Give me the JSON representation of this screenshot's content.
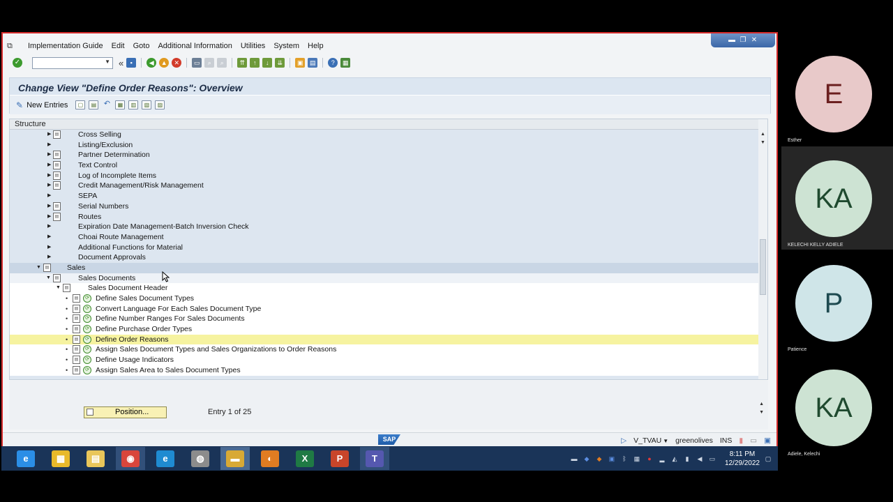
{
  "menubar": {
    "items": [
      "Implementation Guide",
      "Edit",
      "Goto",
      "Additional Information",
      "Utilities",
      "System",
      "Help"
    ]
  },
  "toolbar": {
    "command_value": "",
    "back_glyph": "«"
  },
  "window": {
    "title": "Change View \"Define Order Reasons\": Overview",
    "new_entries_label": "New Entries"
  },
  "tree": {
    "header": "Structure",
    "rows": [
      {
        "label": "Cross Selling",
        "indent": 2,
        "expander": "right",
        "has_doc": true
      },
      {
        "label": "Listing/Exclusion",
        "indent": 2,
        "expander": "right",
        "has_doc": false
      },
      {
        "label": "Partner Determination",
        "indent": 2,
        "expander": "right",
        "has_doc": true
      },
      {
        "label": "Text Control",
        "indent": 2,
        "expander": "right",
        "has_doc": true
      },
      {
        "label": "Log of Incomplete Items",
        "indent": 2,
        "expander": "right",
        "has_doc": true
      },
      {
        "label": "Credit Management/Risk Management",
        "indent": 2,
        "expander": "right",
        "has_doc": true
      },
      {
        "label": "SEPA",
        "indent": 2,
        "expander": "right",
        "has_doc": false
      },
      {
        "label": "Serial Numbers",
        "indent": 2,
        "expander": "right",
        "has_doc": true
      },
      {
        "label": "Routes",
        "indent": 2,
        "expander": "right",
        "has_doc": true
      },
      {
        "label": "Expiration Date Management-Batch Inversion Check",
        "indent": 2,
        "expander": "right",
        "has_doc": false
      },
      {
        "label": "Choai Route Management",
        "indent": 2,
        "expander": "right",
        "has_doc": false
      },
      {
        "label": "Additional Functions for Material",
        "indent": 2,
        "expander": "right",
        "has_doc": false
      },
      {
        "label": "Document Approvals",
        "indent": 2,
        "expander": "right",
        "has_doc": false
      },
      {
        "label": "Sales",
        "indent": 1,
        "expander": "down",
        "has_doc": true,
        "state": "selected"
      },
      {
        "label": "Sales Documents",
        "indent": 2,
        "expander": "down",
        "has_doc": true,
        "state": "header-sel"
      },
      {
        "label": "Sales Document Header",
        "indent": 3,
        "expander": "down",
        "has_doc": true,
        "state": "white"
      },
      {
        "label": "Define Sales Document Types",
        "indent": 4,
        "expander": "bullet",
        "has_doc": true,
        "activity": true,
        "state": "white"
      },
      {
        "label": "Convert Language For Each Sales Document Type",
        "indent": 4,
        "expander": "bullet",
        "has_doc": true,
        "activity": true,
        "state": "white"
      },
      {
        "label": "Define Number Ranges For Sales Documents",
        "indent": 4,
        "expander": "bullet",
        "has_doc": true,
        "activity": true,
        "state": "white"
      },
      {
        "label": "Define Purchase Order Types",
        "indent": 4,
        "expander": "bullet",
        "has_doc": true,
        "activity": true,
        "state": "white"
      },
      {
        "label": "Define Order Reasons",
        "indent": 4,
        "expander": "bullet",
        "has_doc": true,
        "activity": true,
        "state": "hl"
      },
      {
        "label": "Assign Sales Document Types and Sales Organizations to Order Reasons",
        "indent": 4,
        "expander": "bullet",
        "has_doc": true,
        "activity": true,
        "state": "white"
      },
      {
        "label": "Define Usage Indicators",
        "indent": 4,
        "expander": "bullet",
        "has_doc": true,
        "activity": true,
        "state": "white"
      },
      {
        "label": "Assign Sales Area to Sales Document Types",
        "indent": 4,
        "expander": "bullet",
        "has_doc": true,
        "activity": true,
        "state": "white"
      }
    ]
  },
  "bottom": {
    "position_label": "Position...",
    "entry_text": "Entry 1 of 25"
  },
  "statusbar": {
    "sap_logo": "SAP",
    "transaction": "V_TVAU",
    "server": "greenolives",
    "mode": "INS"
  },
  "taskbar": {
    "time": "8:11 PM",
    "date": "12/29/2022",
    "apps": [
      {
        "name": "internet-explorer",
        "glyph": "e",
        "color": "#2b8ee6",
        "state": ""
      },
      {
        "name": "file-manager",
        "glyph": "▦",
        "color": "#e8b92a",
        "state": ""
      },
      {
        "name": "file-explorer",
        "glyph": "▤",
        "color": "#e9c65a",
        "state": ""
      },
      {
        "name": "chrome",
        "glyph": "◉",
        "color": "#d9453b",
        "state": "running"
      },
      {
        "name": "edge",
        "glyph": "e",
        "color": "#1f8bd1",
        "state": ""
      },
      {
        "name": "sap-logon",
        "glyph": "◍",
        "color": "#8c8c8c",
        "state": ""
      },
      {
        "name": "sap-gui",
        "glyph": "▬",
        "color": "#d8a935",
        "state": "active"
      },
      {
        "name": "app-orange",
        "glyph": "◐",
        "color": "#e07c22",
        "state": ""
      },
      {
        "name": "excel",
        "glyph": "X",
        "color": "#1f7a44",
        "state": ""
      },
      {
        "name": "powerpoint",
        "glyph": "P",
        "color": "#c8452a",
        "state": ""
      },
      {
        "name": "teams",
        "glyph": "T",
        "color": "#5558af",
        "state": "running"
      }
    ]
  },
  "participants": [
    {
      "initials": "E",
      "name": "Esther",
      "bg": "#e8c9c9",
      "fg": "#6b1f1f",
      "active": false
    },
    {
      "initials": "KA",
      "name": "KELECHI KELLY ADIELE",
      "bg": "#cde3d3",
      "fg": "#1f4a2f",
      "active": true
    },
    {
      "initials": "P",
      "name": "Patience",
      "bg": "#cfe5e8",
      "fg": "#1e4a50",
      "active": false
    },
    {
      "initials": "KA",
      "name": "Adiele, Kelechi",
      "bg": "#cde3d3",
      "fg": "#1f4a2f",
      "active": false
    }
  ]
}
